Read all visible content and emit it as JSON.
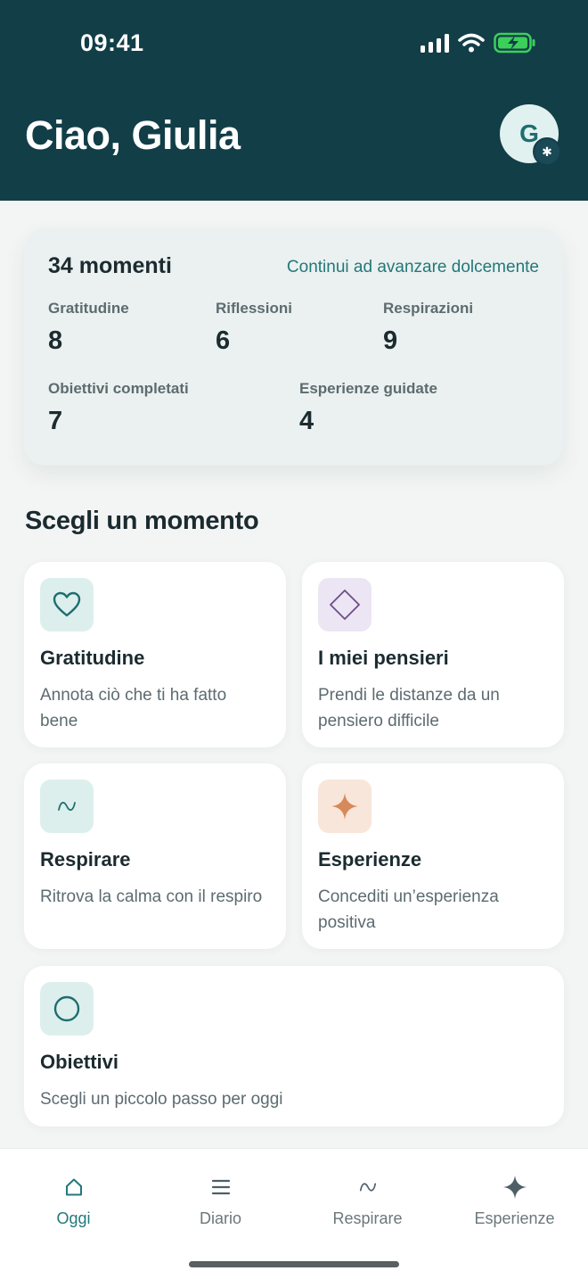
{
  "status_bar": {
    "time": "09:41"
  },
  "header": {
    "greeting": "Ciao, Giulia",
    "avatar_initial": "G"
  },
  "stats": {
    "total": "34 momenti",
    "message": "Continui ad avanzare dolcemente",
    "items": [
      {
        "label": "Gratitudine",
        "value": "8"
      },
      {
        "label": "Riflessioni",
        "value": "6"
      },
      {
        "label": "Respirazioni",
        "value": "9"
      },
      {
        "label": "Obiettivi completati",
        "value": "7"
      },
      {
        "label": "Esperienze guidate",
        "value": "4"
      }
    ]
  },
  "section": {
    "title": "Scegli un momento"
  },
  "tiles": [
    {
      "title": "Gratitudine",
      "desc": "Annota ciò che ti ha fatto bene",
      "icon": "heart-icon"
    },
    {
      "title": "I miei pensieri",
      "desc": "Prendi le distanze da un pensiero difficile",
      "icon": "diamond-icon"
    },
    {
      "title": "Respirare",
      "desc": "Ritrova la calma con il respiro",
      "icon": "wave-icon"
    },
    {
      "title": "Esperienze",
      "desc": "Concediti un’esperienza positiva",
      "icon": "sparkle-icon"
    },
    {
      "title": "Obiettivi",
      "desc": "Scegli un piccolo passo per oggi",
      "icon": "circle-icon"
    }
  ],
  "nav": [
    {
      "label": "Oggi",
      "icon": "home-icon",
      "active": true
    },
    {
      "label": "Diario",
      "icon": "list-icon",
      "active": false
    },
    {
      "label": "Respirare",
      "icon": "wave-icon",
      "active": false
    },
    {
      "label": "Esperienze",
      "icon": "sparkle-icon",
      "active": false
    }
  ],
  "colors": {
    "header_bg": "#123e48",
    "accent": "#23787a",
    "mint_tile": "#dcefed",
    "lilac_tile": "#ece5f4",
    "peach_tile": "#f8e6da"
  }
}
